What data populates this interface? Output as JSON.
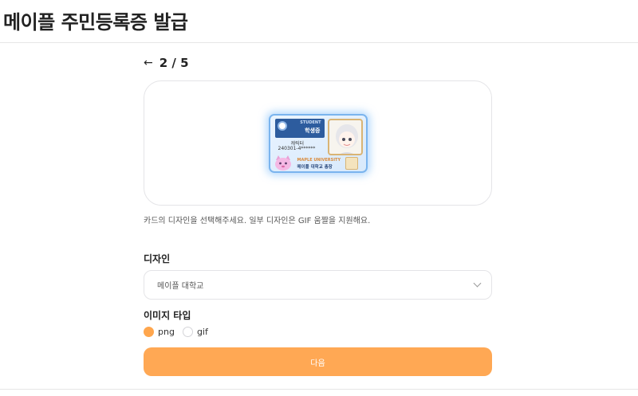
{
  "header": {
    "title": "메이플 주민등록증 발급"
  },
  "step": {
    "back_icon": "arrow-left-icon",
    "arrow": "←",
    "label": "2 / 5"
  },
  "card": {
    "english_label": "STUDENT",
    "type_label": "학생증",
    "name": "캐릭터",
    "number": "240301-4******",
    "university_english": "MAPLE UNIVERSITY",
    "president": "메이플 대학교 총장"
  },
  "hint": "카드의 디자인을 선택해주세요. 일부 디자인은 GIF 움짤을 지원해요.",
  "design": {
    "label": "디자인",
    "selected": "메이플 대학교"
  },
  "image_type": {
    "label": "이미지 타입",
    "options": [
      {
        "label": "png",
        "checked": true
      },
      {
        "label": "gif",
        "checked": false
      }
    ]
  },
  "next_button": {
    "label": "다음",
    "color": "#ffa854"
  },
  "colors": {
    "accent": "#ffa64d",
    "border": "#e4e4e7"
  }
}
